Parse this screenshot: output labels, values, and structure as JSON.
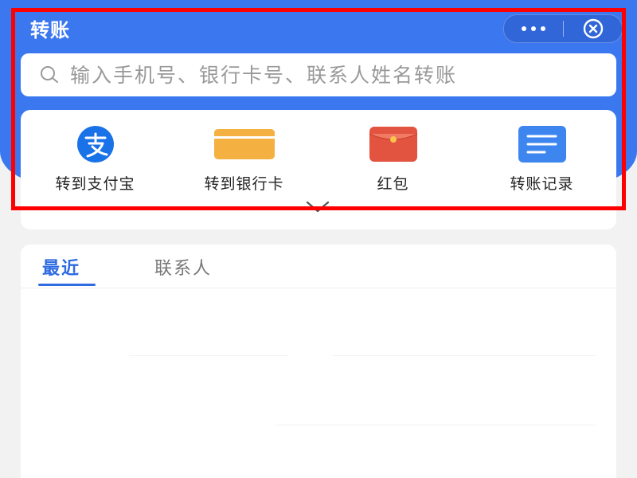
{
  "header": {
    "title": "转账"
  },
  "search": {
    "placeholder": "输入手机号、银行卡号、联系人姓名转账"
  },
  "quick_actions": [
    {
      "label": "转到支付宝",
      "icon": "alipay-icon"
    },
    {
      "label": "转到银行卡",
      "icon": "bank-card-icon"
    },
    {
      "label": "红包",
      "icon": "red-envelope-icon"
    },
    {
      "label": "转账记录",
      "icon": "transfer-record-icon"
    }
  ],
  "tabs": [
    {
      "label": "最近",
      "active": true
    },
    {
      "label": "联系人",
      "active": false
    }
  ],
  "colors": {
    "primary": "#3b78f0",
    "alipay": "#1a72e8",
    "bank_card": "#f4b041",
    "red_envelope": "#e35440",
    "record": "#3d86f0",
    "highlight": "#ff0000"
  }
}
